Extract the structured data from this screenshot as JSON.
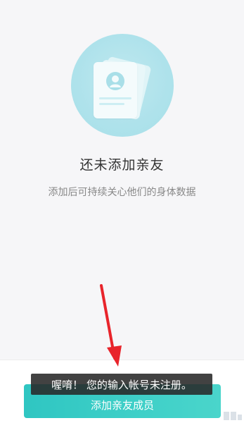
{
  "empty_state": {
    "illustration_icon": "contact-cards-icon",
    "title": "还未添加亲友",
    "subtitle": "添加后可持续关心他们的身体数据"
  },
  "annotation": {
    "arrow_color": "#e8242b"
  },
  "toast": {
    "message": "喔唷！ 您的输入帐号未注册。"
  },
  "bottom": {
    "add_button_label": "添加亲友成员"
  },
  "colors": {
    "accent": "#3fd0c8",
    "background": "#f6f6f8"
  }
}
